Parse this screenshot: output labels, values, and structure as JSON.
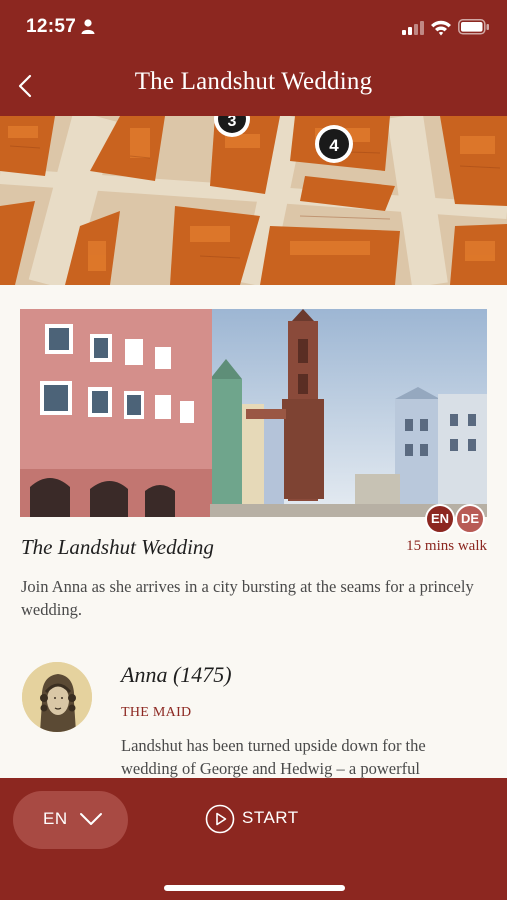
{
  "status_bar": {
    "time": "12:57"
  },
  "nav": {
    "title": "The Landshut Wedding"
  },
  "map": {
    "markers": [
      "3",
      "4"
    ]
  },
  "tour": {
    "languages": [
      "EN",
      "DE"
    ],
    "title": "The Landshut Wedding",
    "duration": "15 mins walk",
    "description": "Join Anna as she arrives in a city bursting at the seams for a princely wedding."
  },
  "character": {
    "name": "Anna (1475)",
    "role": "THE MAID",
    "bio": "Landshut has been turned upside down for the wedding of George and Hedwig – a powerful"
  },
  "bottom_bar": {
    "language": "EN",
    "start_label": "START"
  },
  "colors": {
    "brand": "#8c2720",
    "brand_light": "#a84a43",
    "background": "#faf8f3"
  },
  "icons": [
    "person-icon",
    "signal-icon",
    "wifi-icon",
    "battery-icon",
    "back-chevron-icon",
    "chevron-down-icon",
    "play-icon"
  ]
}
